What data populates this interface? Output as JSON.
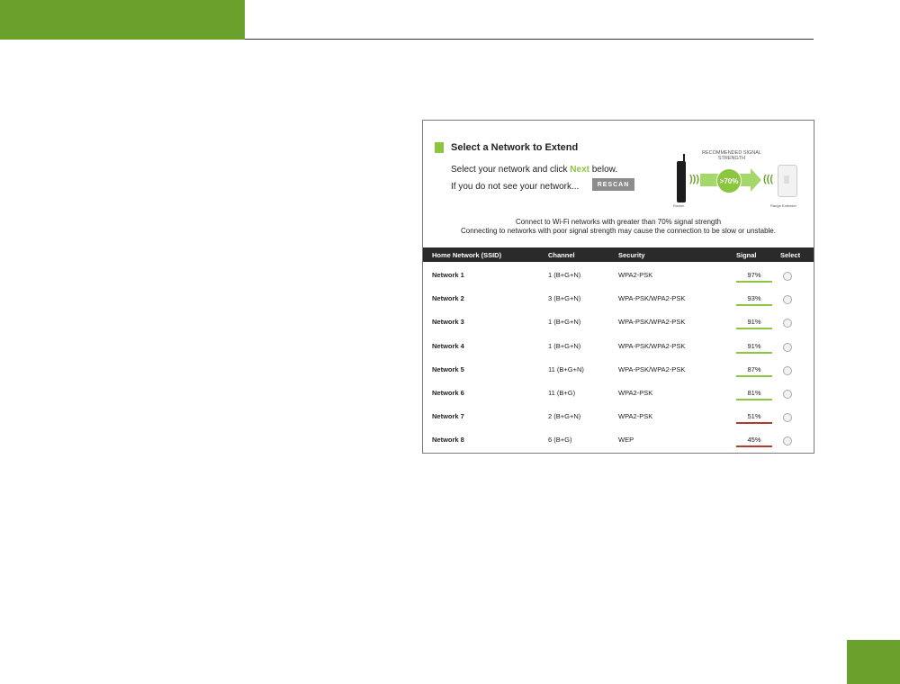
{
  "panel": {
    "title": "Select a Network to Extend",
    "instruction_pre": "Select your network and click ",
    "instruction_next": "Next",
    "instruction_post": " below.",
    "hint": "If you do not see your network...",
    "rescan_label": "RESCAN",
    "illustration": {
      "recommended_label": "RECOMMENDED SIGNAL STRENGTH",
      "threshold": ">70%",
      "router_caption": "Router",
      "extender_caption": "Range Extender"
    },
    "info_line1": "Connect to Wi-Fi networks with greater than 70% signal strength",
    "info_line2": "Connecting to networks with poor signal strength may cause the connection to be slow or unstable."
  },
  "table": {
    "headers": {
      "ssid": "Home Network (SSID)",
      "channel": "Channel",
      "security": "Security",
      "signal": "Signal",
      "select": "Select"
    },
    "rows": [
      {
        "ssid": "Network 1",
        "channel": "1 (B+G+N)",
        "security": "WPA2-PSK",
        "signal": "97%",
        "signal_color": "#8cc63f"
      },
      {
        "ssid": "Network 2",
        "channel": "3 (B+G+N)",
        "security": "WPA-PSK/WPA2-PSK",
        "signal": "93%",
        "signal_color": "#8cc63f"
      },
      {
        "ssid": "Network 3",
        "channel": "1 (B+G+N)",
        "security": "WPA-PSK/WPA2-PSK",
        "signal": "91%",
        "signal_color": "#8cc63f"
      },
      {
        "ssid": "Network 4",
        "channel": "1 (B+G+N)",
        "security": "WPA-PSK/WPA2-PSK",
        "signal": "91%",
        "signal_color": "#8cc63f"
      },
      {
        "ssid": "Network 5",
        "channel": "11 (B+G+N)",
        "security": "WPA-PSK/WPA2-PSK",
        "signal": "87%",
        "signal_color": "#8cc63f"
      },
      {
        "ssid": "Network 6",
        "channel": "11 (B+G)",
        "security": "WPA2-PSK",
        "signal": "81%",
        "signal_color": "#8cc63f"
      },
      {
        "ssid": "Network 7",
        "channel": "2 (B+G+N)",
        "security": "WPA2-PSK",
        "signal": "51%",
        "signal_color": "#b03a2e"
      },
      {
        "ssid": "Network 8",
        "channel": "6 (B+G)",
        "security": "WEP",
        "signal": "45%",
        "signal_color": "#b03a2e"
      }
    ]
  },
  "colors": {
    "brand_green": "#6aa02c",
    "accent_green": "#8cc63f",
    "weak_red": "#b03a2e"
  }
}
